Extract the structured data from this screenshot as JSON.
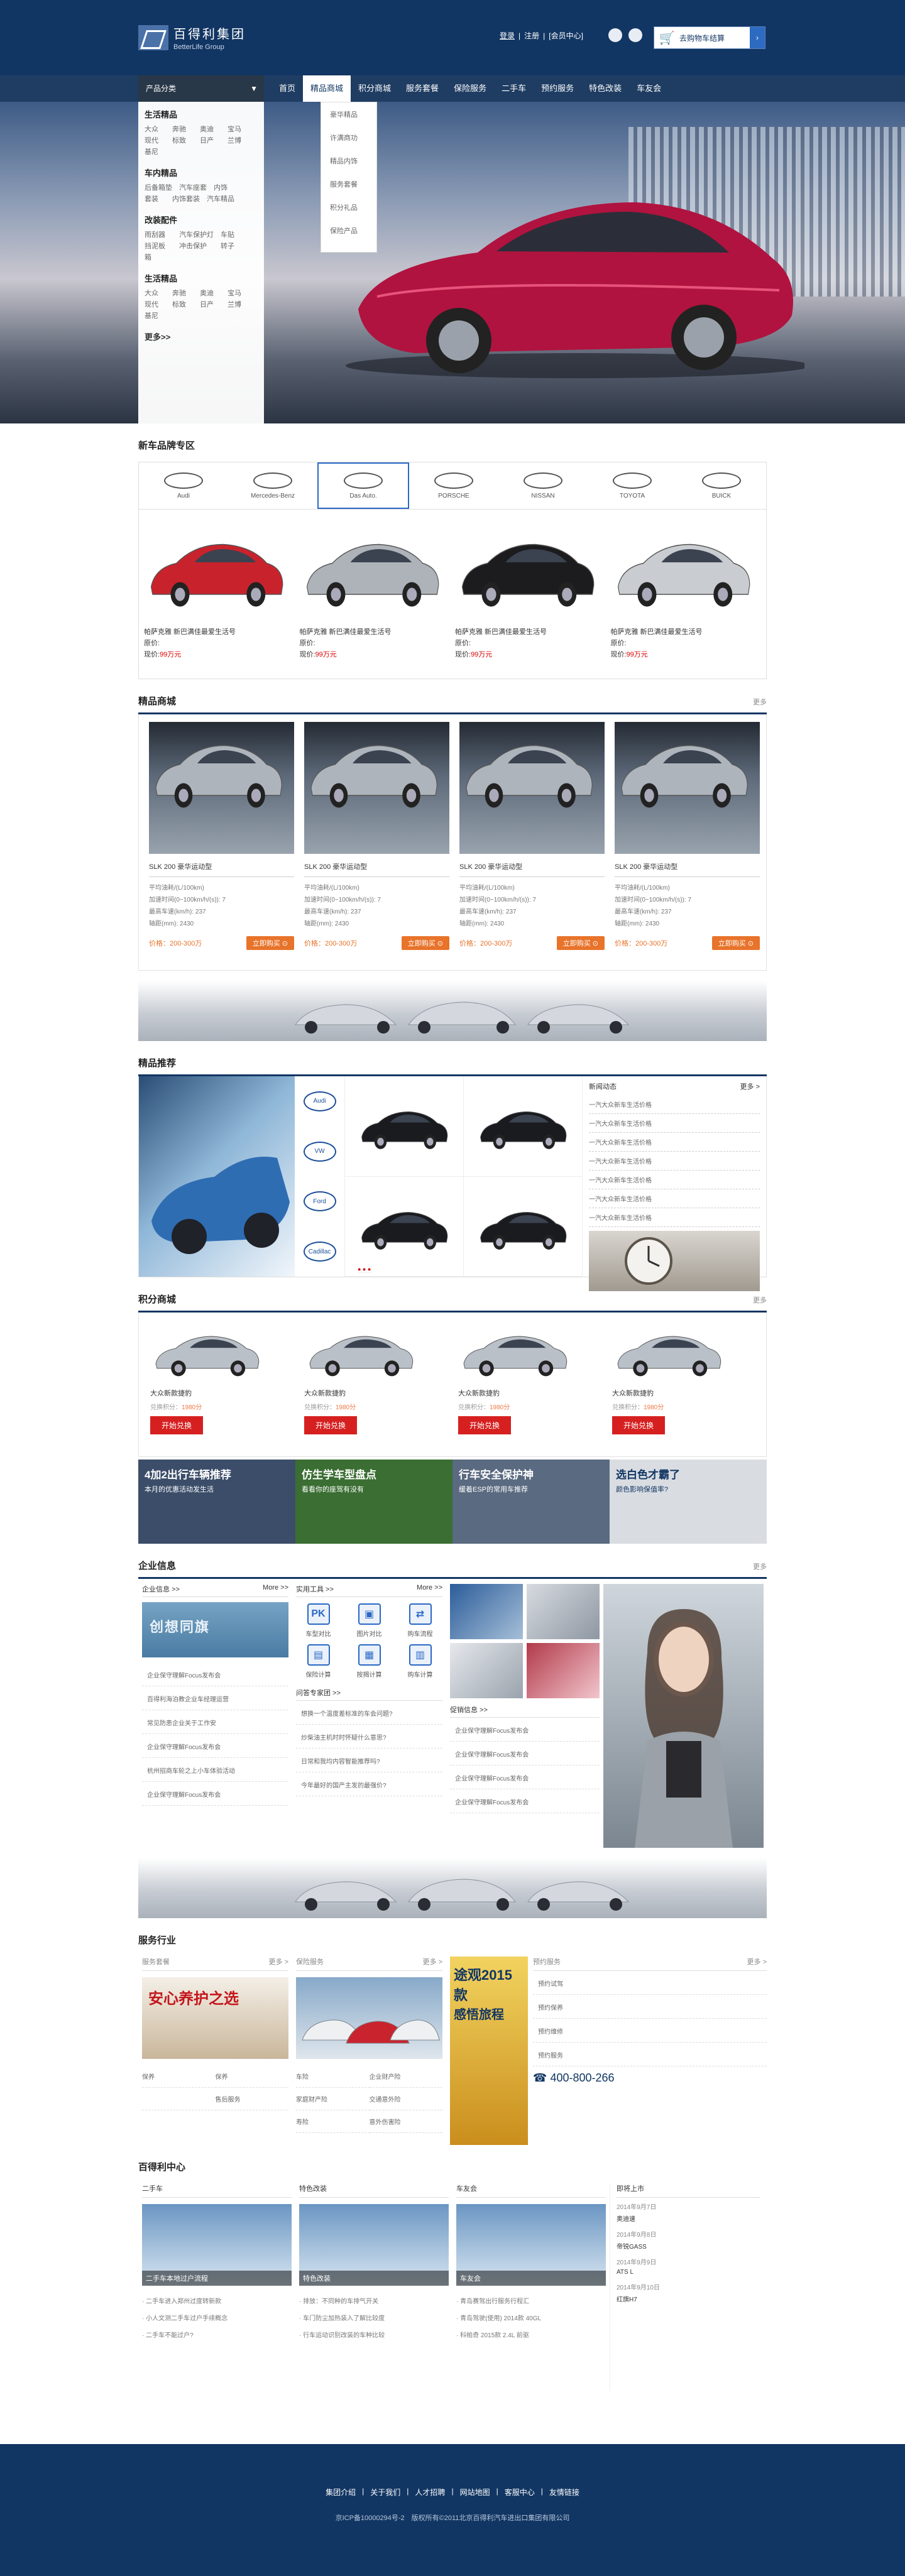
{
  "header": {
    "logo_name": "百得利集团",
    "logo_sub": "BetterLife Group",
    "login": "登录",
    "sep1": "|",
    "register": "注册",
    "sep2": "|",
    "member": "[会员中心]",
    "cart_label": "去购物车结算"
  },
  "nav": {
    "category_label": "产品分类",
    "items": [
      "首页",
      "精品商城",
      "积分商城",
      "服务套餐",
      "保险服务",
      "二手车",
      "预约服务",
      "特色改装",
      "车友会"
    ],
    "active": 1
  },
  "category_panel": {
    "groups": [
      {
        "title": "生活精品",
        "lines": [
          "大众　　奔驰　　奥迪　　宝马",
          "现代　　标致　　日产　　兰博",
          "基尼"
        ]
      },
      {
        "title": "车内精品",
        "lines": [
          "后备箱垫　汽车座套　内饰",
          "套装　　内饰套装　汽车精品"
        ]
      },
      {
        "title": "改装配件",
        "lines": [
          "雨刮器　　汽车保护灯　车贴",
          "挡泥板　　冲击保护　　转子",
          "箱"
        ]
      },
      {
        "title": "生活精品",
        "lines": [
          "大众　　奔驰　　奥迪　　宝马",
          "现代　　标致　　日产　　兰博",
          "基尼"
        ]
      }
    ],
    "more": "更多>>"
  },
  "submenu": [
    "豪华精品",
    "许满商功",
    "精品内饰",
    "服务套餐",
    "积分礼品",
    "保险产品"
  ],
  "new_cars": {
    "title": "新车品牌专区",
    "brands": [
      "Audi",
      "Mercedes-Benz",
      "Das Auto.",
      "PORSCHE",
      "NISSAN",
      "TOYOTA",
      "BUICK"
    ],
    "active_brand": 2,
    "cars": [
      {
        "name": "帕萨克雅 新巴满佳最爱生活号",
        "price_label": "原价:",
        "now_label": "现价:",
        "price": "99万元",
        "color": "#c8232c"
      },
      {
        "name": "帕萨克雅 新巴满佳最爱生活号",
        "price_label": "原价:",
        "now_label": "现价:",
        "price": "99万元",
        "color": "#aeb3b9"
      },
      {
        "name": "帕萨克雅 新巴满佳最爱生活号",
        "price_label": "原价:",
        "now_label": "现价:",
        "price": "99万元",
        "color": "#1c1c1e"
      },
      {
        "name": "帕萨克雅 新巴满佳最爱生活号",
        "price_label": "原价:",
        "now_label": "现价:",
        "price": "99万元",
        "color": "#c9ccd0"
      }
    ]
  },
  "shop": {
    "title": "精品商城",
    "more": "更多",
    "products": [
      {
        "name": "SLK 200 豪华运动型",
        "desc": [
          "平均油耗/(L/100km)",
          "加速时间(0~100km/h/(s)): 7",
          "最高车速(km/h): 237",
          "轴距(mm): 2430"
        ],
        "price": "价格：200-300万",
        "buy": "立即购买 ⊙"
      },
      {
        "name": "SLK 200 豪华运动型",
        "desc": [
          "平均油耗/(L/100km)",
          "加速时间(0~100km/h/(s)): 7",
          "最高车速(km/h): 237",
          "轴距(mm): 2430"
        ],
        "price": "价格：200-300万",
        "buy": "立即购买 ⊙"
      },
      {
        "name": "SLK 200 豪华运动型",
        "desc": [
          "平均油耗/(L/100km)",
          "加速时间(0~100km/h/(s)): 7",
          "最高车速(km/h): 237",
          "轴距(mm): 2430"
        ],
        "price": "价格：200-300万",
        "buy": "立即购买 ⊙"
      },
      {
        "name": "SLK 200 豪华运动型",
        "desc": [
          "平均油耗/(L/100km)",
          "加速时间(0~100km/h/(s)): 7",
          "最高车速(km/h): 237",
          "轴距(mm): 2430"
        ],
        "price": "价格：200-300万",
        "buy": "立即购买 ⊙"
      }
    ]
  },
  "recommend": {
    "title": "精品推荐",
    "brands": [
      "Audi",
      "VW",
      "Ford",
      "Cadillac"
    ],
    "news_title": "新闻动态",
    "news_more": "更多 >",
    "news": [
      "一汽大众新车生活价格",
      "一汽大众新车生活价格",
      "一汽大众新车生活价格",
      "一汽大众新车生活价格",
      "一汽大众新车生活价格",
      "一汽大众新车生活价格",
      "一汽大众新车生活价格"
    ]
  },
  "points": {
    "title": "积分商城",
    "more": "更多",
    "items": [
      {
        "name": "大众新款捷豹",
        "pts_label": "兑换积分：",
        "pts": "1980分",
        "btn": "开始兑换"
      },
      {
        "name": "大众新款捷豹",
        "pts_label": "兑换积分：",
        "pts": "1980分",
        "btn": "开始兑换"
      },
      {
        "name": "大众新款捷豹",
        "pts_label": "兑换积分：",
        "pts": "1980分",
        "btn": "开始兑换"
      },
      {
        "name": "大众新款捷豹",
        "pts_label": "兑换积分：",
        "pts": "1980分",
        "btn": "开始兑换"
      }
    ],
    "ads": [
      {
        "title": "4加2出行车辆推荐",
        "sub": "本月的优惠活动发生活",
        "color": "#3b4d69"
      },
      {
        "title": "仿生学车型盘点",
        "sub": "看看你的座驾有没有",
        "color": "#3a6e32"
      },
      {
        "title": "行车安全保护神",
        "sub": "缓着ESP的常用车推荐",
        "color": "#5a6a80"
      },
      {
        "title": "选白色才霸了",
        "sub": "颜色影响保值率?",
        "color": "#d9dde2"
      }
    ]
  },
  "enterprise": {
    "title": "企业信息",
    "more": "更多",
    "news_h": "企业信息 >>",
    "news_more": "More >>",
    "banner": "创想同旗",
    "news": [
      "企业保守理解Focus发布会",
      "百得利海泊教企业车经理运营",
      "常见防患企业关于工作安",
      "企业保守理解Focus发布会",
      "杭州招商车轮之上小车体验活动",
      "企业保守理解Focus发布会"
    ],
    "tools_h": "实用工具 >>",
    "tools_more": "More >>",
    "tools": [
      {
        "label": "车型对比",
        "glyph": "PK"
      },
      {
        "label": "图片对比",
        "glyph": "▣"
      },
      {
        "label": "购车流程",
        "glyph": "⇄"
      },
      {
        "label": "保险计算",
        "glyph": "▤"
      },
      {
        "label": "按揭计算",
        "glyph": "▦"
      },
      {
        "label": "购车计算",
        "glyph": "▥"
      }
    ],
    "qa_h": "问答专家团 >>",
    "qa": [
      "想换一个温度差标准的车会问题?",
      "炒柴油主机时时怀疑什么意思?",
      "日常和我均内容智能推荐吗?",
      "今年最好的国产主发的最强价?"
    ],
    "hl_h": "促销信息 >>",
    "hl": [
      "企业保守理解Focus发布会",
      "企业保守理解Focus发布会",
      "企业保守理解Focus发布会",
      "企业保守理解Focus发布会"
    ]
  },
  "service": {
    "title": "服务行业",
    "cols": [
      {
        "h": "服务套餐",
        "more": "更多 >",
        "img_text": "安心养护之选",
        "links": [
          "保养",
          "保养",
          "",
          "售后服务"
        ]
      },
      {
        "h": "保险服务",
        "more": "更多 >",
        "links": [
          "车险",
          "企业财产险",
          "家庭财产险",
          "交通意外险",
          "寿险",
          "意外伤害险"
        ]
      },
      {
        "h": "预约服务",
        "more": "更多 >",
        "links": [
          "预约试驾",
          "预约保养",
          "预约维修",
          "预约服务"
        ]
      }
    ],
    "poster_t1": "途观2015款",
    "poster_t2": "感悟旅程",
    "phone": "400-800-266"
  },
  "center": {
    "title": "百得利中心",
    "cols": [
      {
        "h": "二手车",
        "cap": "二手车本地过户流程",
        "list": [
          "二手车进入郑州过度转新款",
          "小人文测二手车过户手续概念",
          "二手车不能过户?"
        ]
      },
      {
        "h": "特色改装",
        "cap": "特色改装",
        "list": [
          "排放：不同种的车排气开关",
          "车门防尘加热装入了解比较度",
          "行车运动识别改装的车种比较"
        ]
      },
      {
        "h": "车友会",
        "cap": "车友会",
        "list": [
          "青岛赛驾出行服务行程汇",
          "青岛驾驶(使用) 2014款 40GL",
          "科帕奇 2015款 2.4L 前驱"
        ]
      }
    ],
    "soon_h": "即将上市",
    "soon": [
      {
        "date": "2014年9月7日",
        "name": "奥迪速"
      },
      {
        "date": "2014年9月8日",
        "name": "帝锐GASS"
      },
      {
        "date": "2014年9月9日",
        "name": "ATS L"
      },
      {
        "date": "2014年9月10日",
        "name": "红旗H7"
      }
    ]
  },
  "footer": {
    "links": [
      "集团介绍",
      "|",
      "关于我们",
      "|",
      "人才招聘",
      "|",
      "网站地图",
      "|",
      "客服中心",
      "|",
      "友情链接"
    ],
    "copy": "京ICP备10000294号-2　版权所有©2011北京百得利汽车进出口集团有限公司"
  }
}
